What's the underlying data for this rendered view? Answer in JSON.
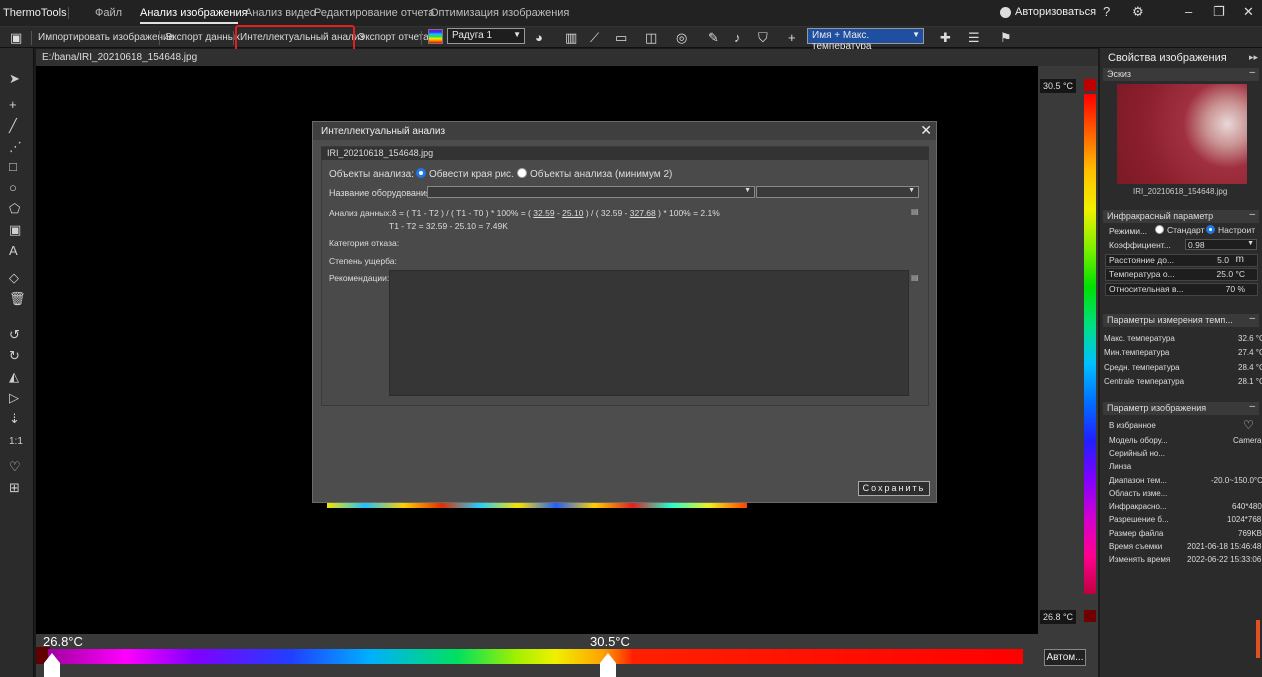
{
  "app": {
    "title": "ThermoTools"
  },
  "menu": {
    "items": [
      "Файл",
      "Анализ изображения",
      "Анализ видео",
      "Редактирование отчета",
      "Оптимизация изображения"
    ],
    "login": "Авторизоваться"
  },
  "toolbar": {
    "import": "Импортировать изображение",
    "export_data": "Экспорт данных",
    "intelligent": "Интеллектуальный анализ",
    "export_report": "Экспорт отчета",
    "palette": "Радуга 1",
    "overlay": "Имя + Макс. температура"
  },
  "file": {
    "path": "E:/bana/IRI_20210618_154648.jpg"
  },
  "scale": {
    "max": "30.5 °C",
    "min": "26.8 °C"
  },
  "colorbar": {
    "left": "26.8°C",
    "right": "30.5°C",
    "auto": "Автом..."
  },
  "right_panel": {
    "title": "Свойства изображения",
    "sketch": {
      "header": "Эскиз",
      "filename": "IRI_20210618_154648.jpg"
    },
    "ir": {
      "header": "Инфракрасный параметр",
      "mode_label": "Режими...",
      "mode_standard": "Стандарт",
      "mode_custom": "Настроит",
      "emissivity_label": "Коэффициент...",
      "emissivity": "0.98",
      "distance_label": "Расстояние до...",
      "distance": "5.0",
      "distance_unit": "m",
      "temp_label": "Температура о...",
      "temp": "25.0 °C",
      "humidity_label": "Относительная в...",
      "humidity": "70 %"
    },
    "measure": {
      "header": "Параметры измерения темп...",
      "rows": [
        {
          "k": "Макс. температура",
          "v": "32.6 °C"
        },
        {
          "k": "Мин.температура",
          "v": "27.4 °C"
        },
        {
          "k": "Средн. температура",
          "v": "28.4 °C"
        },
        {
          "k": "Centrale температура",
          "v": "28.1 °C"
        }
      ]
    },
    "image": {
      "header": "Параметр изображения",
      "favorite": "В избранное",
      "rows": [
        {
          "k": "Модель обору...",
          "v": "Camera"
        },
        {
          "k": "Серийный но...",
          "v": ""
        },
        {
          "k": "Линза",
          "v": ""
        },
        {
          "k": "Диапазон тем...",
          "v": "-20.0~150.0°C"
        },
        {
          "k": "Область изме...",
          "v": ""
        },
        {
          "k": "Инфракрасно...",
          "v": "640*480"
        },
        {
          "k": "Разрешение б...",
          "v": "1024*768"
        },
        {
          "k": "Размер файла",
          "v": "769KB"
        },
        {
          "k": "Время съемки",
          "v": "2021-06-18 15:46:48"
        },
        {
          "k": "Изменять время",
          "v": "2022-06-22 15:33:06"
        }
      ]
    }
  },
  "dialog": {
    "title": "Интеллектуальный анализ",
    "file": "IRI_20210618_154648.jpg",
    "objects_label": "Объекты анализа:",
    "opt_edge": "Обвести края рис.",
    "opt_objects": "Объекты анализа (минимум 2)",
    "equipment_label": "Название оборудования:",
    "analysis_prefix": "Анализ данных:δ = ( T1 - T2 ) / ( T1 - T0 ) * 100% = (",
    "v1": "32.59",
    "minus": "-",
    "v2": "25.10",
    "mid": ") / ( 32.59 -",
    "v3": "327.68",
    "suffix": ") * 100% = 2.1%",
    "line2": "T1 - T2 = 32.59 - 25.10 = 7.49K",
    "fault_label": "Категория отказа:",
    "damage_label": "Степень ущерба:",
    "reco_label": "Рекомендации:",
    "save": "Сохранить"
  }
}
